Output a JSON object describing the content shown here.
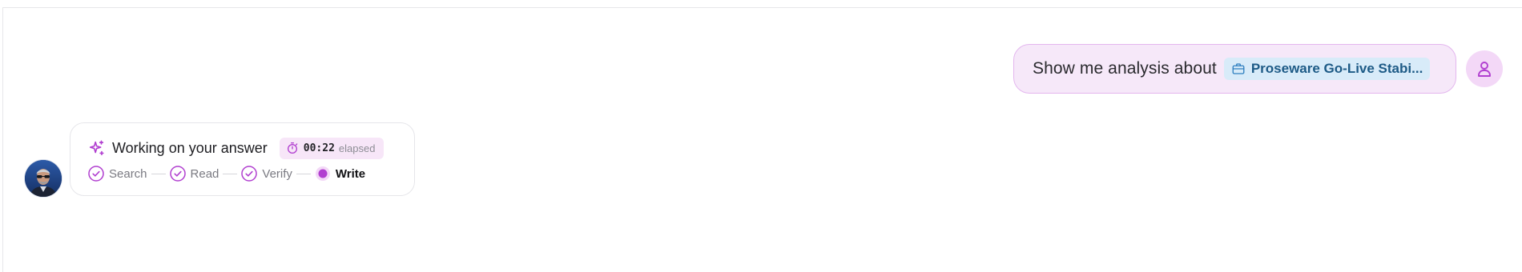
{
  "conversation": {
    "user_message": {
      "text": "Show me analysis about",
      "chip": {
        "icon": "briefcase-icon",
        "label": "Proseware Go-Live Stabi..."
      },
      "avatar_icon": "user-icon"
    },
    "assistant_status": {
      "avatar": "assistant-avatar-photo",
      "icon": "sparkle-icon",
      "title": "Working on your answer",
      "timer": {
        "icon": "stopwatch-icon",
        "value": "00:22",
        "suffix": "elapsed"
      },
      "steps": [
        {
          "label": "Search",
          "state": "done"
        },
        {
          "label": "Read",
          "state": "done"
        },
        {
          "label": "Verify",
          "state": "done"
        },
        {
          "label": "Write",
          "state": "active"
        }
      ]
    }
  },
  "colors": {
    "accent": "#b13fd0",
    "user_bubble_bg": "#f6e8f9",
    "chip_bg": "#d8ebf9",
    "chip_text": "#1d5a86"
  }
}
